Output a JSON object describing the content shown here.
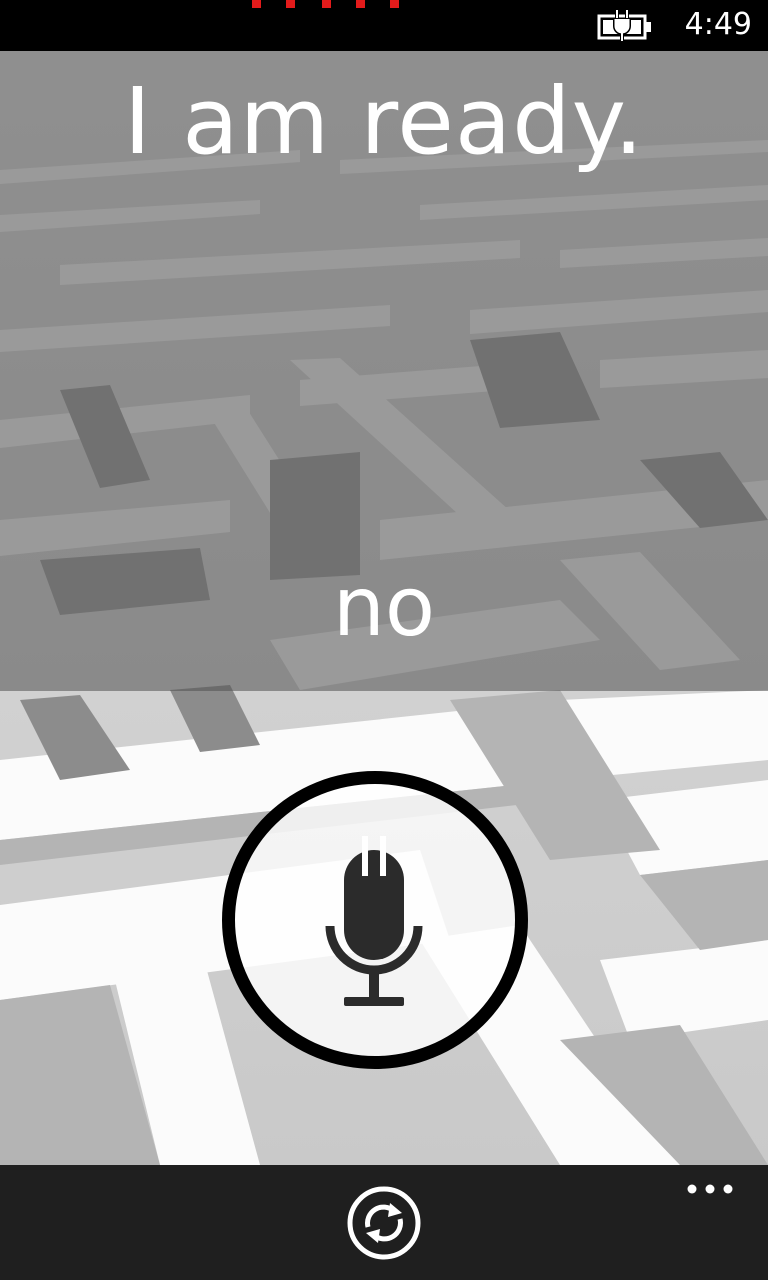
{
  "status_bar": {
    "time": "4:49",
    "battery_icon": "battery-charging-icon",
    "signal_icon": "signal-bars-icon",
    "signal_color": "#e31b1b"
  },
  "main": {
    "headline": "I am ready.",
    "recognized_word": "no",
    "mic_icon": "microphone-icon"
  },
  "app_bar": {
    "refresh_icon": "refresh-icon",
    "more_icon": "ellipsis-icon",
    "background": "#1f1f1f"
  }
}
